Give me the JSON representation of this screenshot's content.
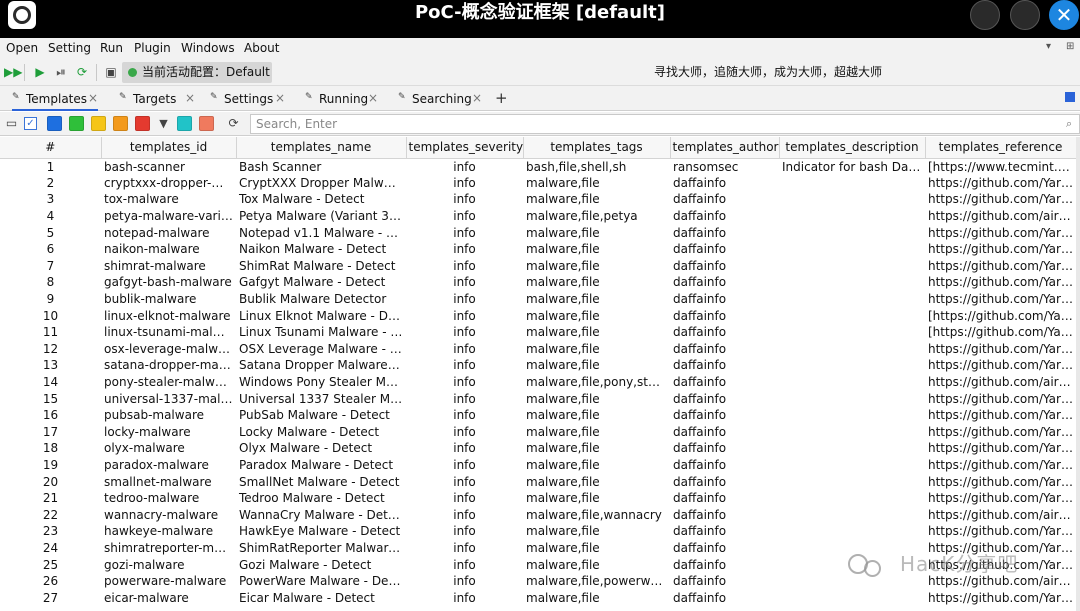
{
  "window": {
    "title": "PoC-概念验证框架 [default]",
    "close_glyph": "✕"
  },
  "menu": [
    "Open",
    "Setting",
    "Run",
    "Plugin",
    "Windows",
    "About"
  ],
  "toolbar": {
    "config_label": "当前活动配置：Default",
    "motto": "寻找大师，追随大师，成为大师，超越大师"
  },
  "tabs": [
    {
      "label": "Templates",
      "active": true
    },
    {
      "label": "Targets",
      "active": false
    },
    {
      "label": "Settings",
      "active": false
    },
    {
      "label": "Running",
      "active": false
    },
    {
      "label": "Searching",
      "active": false
    }
  ],
  "filter": {
    "colors": [
      "#1e6fe0",
      "#2fbf3a",
      "#f5c518",
      "#f39a1c",
      "#e43a2f",
      "#21c3c8",
      "#f07a5e"
    ],
    "search_placeholder": "Search, Enter"
  },
  "table": {
    "columns": [
      "#",
      "templates_id",
      "templates_name",
      "templates_severity",
      "templates_tags",
      "templates_author",
      "templates_description",
      "templates_reference"
    ],
    "rows": [
      [
        "1",
        "bash-scanner",
        "Bash Scanner",
        "info",
        "bash,file,shell,sh",
        "ransomsec",
        "Indicator for bash Dange...",
        "[https://www.tecmint.co..."
      ],
      [
        "2",
        "cryptxxx-dropper-mal...",
        "CryptXXX Dropper Malware ...",
        "info",
        "malware,file",
        "daffainfo",
        "",
        "https://github.com/Yara..."
      ],
      [
        "3",
        "tox-malware",
        "Tox Malware - Detect",
        "info",
        "malware,file",
        "daffainfo",
        "",
        "https://github.com/Yara..."
      ],
      [
        "4",
        "petya-malware-varia...",
        "Petya Malware (Variant 3) - ...",
        "info",
        "malware,file,petya",
        "daffainfo",
        "",
        "https://github.com/airbn..."
      ],
      [
        "5",
        "notepad-malware",
        "Notepad v1.1 Malware - Det...",
        "info",
        "malware,file",
        "daffainfo",
        "",
        "https://github.com/Yara..."
      ],
      [
        "6",
        "naikon-malware",
        "Naikon Malware - Detect",
        "info",
        "malware,file",
        "daffainfo",
        "",
        "https://github.com/Yara..."
      ],
      [
        "7",
        "shimrat-malware",
        "ShimRat Malware - Detect",
        "info",
        "malware,file",
        "daffainfo",
        "",
        "https://github.com/Yara..."
      ],
      [
        "8",
        "gafgyt-bash-malware",
        "Gafgyt Malware - Detect",
        "info",
        "malware,file",
        "daffainfo",
        "",
        "https://github.com/Yara..."
      ],
      [
        "9",
        "bublik-malware",
        "Bublik Malware Detector",
        "info",
        "malware,file",
        "daffainfo",
        "",
        "https://github.com/Yara..."
      ],
      [
        "10",
        "linux-elknot-malware",
        "Linux Elknot Malware - Detect",
        "info",
        "malware,file",
        "daffainfo",
        "",
        "[https://github.com/Yar..."
      ],
      [
        "11",
        "linux-tsunami-malware",
        "Linux Tsunami Malware - De...",
        "info",
        "malware,file",
        "daffainfo",
        "",
        "[https://github.com/Yar..."
      ],
      [
        "12",
        "osx-leverage-malware",
        "OSX Leverage Malware - De...",
        "info",
        "malware,file",
        "daffainfo",
        "",
        "https://github.com/Yara..."
      ],
      [
        "13",
        "satana-dropper-malw...",
        "Satana Dropper Malware - ...",
        "info",
        "malware,file",
        "daffainfo",
        "",
        "https://github.com/Yara..."
      ],
      [
        "14",
        "pony-stealer-malware",
        "Windows Pony Stealer Malw...",
        "info",
        "malware,file,pony,stealer",
        "daffainfo",
        "",
        "https://github.com/airbn..."
      ],
      [
        "15",
        "universal-1337-malw...",
        "Universal 1337 Stealer Malw...",
        "info",
        "malware,file",
        "daffainfo",
        "",
        "https://github.com/Yara..."
      ],
      [
        "16",
        "pubsab-malware",
        "PubSab Malware - Detect",
        "info",
        "malware,file",
        "daffainfo",
        "",
        "https://github.com/Yara..."
      ],
      [
        "17",
        "locky-malware",
        "Locky Malware - Detect",
        "info",
        "malware,file",
        "daffainfo",
        "",
        "https://github.com/Yara..."
      ],
      [
        "18",
        "olyx-malware",
        "Olyx Malware - Detect",
        "info",
        "malware,file",
        "daffainfo",
        "",
        "https://github.com/Yara..."
      ],
      [
        "19",
        "paradox-malware",
        "Paradox Malware - Detect",
        "info",
        "malware,file",
        "daffainfo",
        "",
        "https://github.com/Yara..."
      ],
      [
        "20",
        "smallnet-malware",
        "SmallNet Malware - Detect",
        "info",
        "malware,file",
        "daffainfo",
        "",
        "https://github.com/Yara..."
      ],
      [
        "21",
        "tedroo-malware",
        "Tedroo Malware - Detect",
        "info",
        "malware,file",
        "daffainfo",
        "",
        "https://github.com/Yara..."
      ],
      [
        "22",
        "wannacry-malware",
        "WannaCry Malware - Detect",
        "info",
        "malware,file,wannacry",
        "daffainfo",
        "",
        "https://github.com/airbn..."
      ],
      [
        "23",
        "hawkeye-malware",
        "HawkEye Malware - Detect",
        "info",
        "malware,file",
        "daffainfo",
        "",
        "https://github.com/Yara..."
      ],
      [
        "24",
        "shimratreporter-mal...",
        "ShimRatReporter Malware -...",
        "info",
        "malware,file",
        "daffainfo",
        "",
        "https://github.com/Yara..."
      ],
      [
        "25",
        "gozi-malware",
        "Gozi Malware - Detect",
        "info",
        "malware,file",
        "daffainfo",
        "",
        "https://github.com/Yara..."
      ],
      [
        "26",
        "powerware-malware",
        "PowerWare Malware - Detect",
        "info",
        "malware,file,powerware",
        "daffainfo",
        "",
        "https://github.com/airbn..."
      ],
      [
        "27",
        "eicar-malware",
        "Eicar Malware - Detect",
        "info",
        "malware,file",
        "daffainfo",
        "",
        "https://github.com/Yara..."
      ]
    ]
  },
  "watermark": {
    "text": "HacK分享吧"
  }
}
